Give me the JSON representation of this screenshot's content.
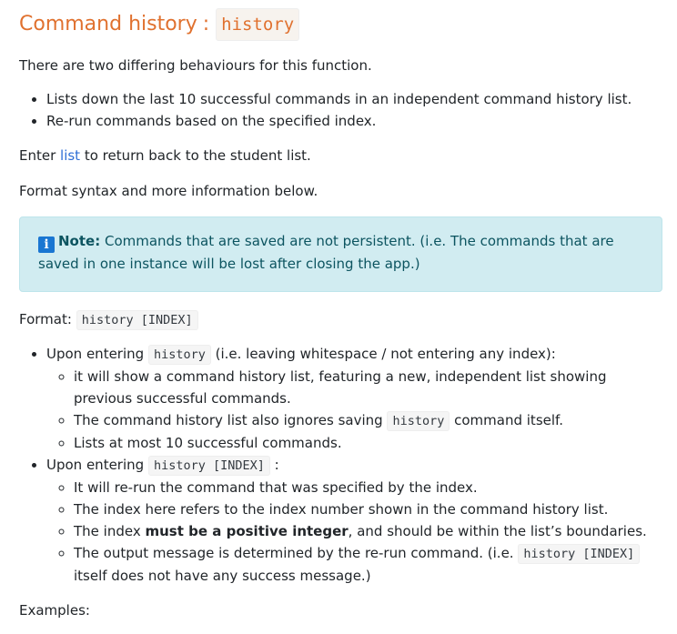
{
  "section": {
    "title": "Command history",
    "title_sep": ":",
    "title_code": "history"
  },
  "intro": "There are two differing behaviours for this function.",
  "behaviours": [
    "Lists down the last 10 successful commands in an independent command history list.",
    "Re-run commands based on the specified index."
  ],
  "return_line": {
    "prefix": "Enter ",
    "link": "list",
    "suffix": " to return back to the student list."
  },
  "format_intro": "Format syntax and more information below.",
  "note": {
    "icon": "info-icon",
    "label": "Note:",
    "text": " Commands that are saved are not persistent. (i.e. The commands that are saved in one instance will be lost after closing the app.)"
  },
  "format": {
    "label": "Format: ",
    "code": "history [INDEX]"
  },
  "usage": [
    {
      "prefix": "Upon entering ",
      "code": "history",
      "suffix": " (i.e. leaving whitespace / not entering any index):",
      "details": [
        {
          "text": "it will show a command history list, featuring a new, independent list showing previous successful commands."
        },
        {
          "prefix": "The command history list also ignores saving ",
          "code": "history",
          "suffix": " command itself."
        },
        {
          "text": "Lists at most 10 successful commands."
        }
      ]
    },
    {
      "prefix": "Upon entering ",
      "code": "history [INDEX]",
      "suffix": " :",
      "details": [
        {
          "text": "It will re-run the command that was specified by the index."
        },
        {
          "text": "The index here refers to the index number shown in the command history list."
        },
        {
          "prefix": "The index ",
          "bold": "must be a positive integer",
          "suffix": ", and should be within the list’s boundaries."
        },
        {
          "prefix": "The output message is determined by the re-run command. (i.e. ",
          "code": "history [INDEX]",
          "suffix": " itself does not have any success message.)"
        }
      ]
    }
  ],
  "examples_label": "Examples:"
}
